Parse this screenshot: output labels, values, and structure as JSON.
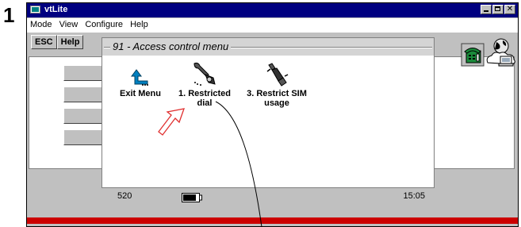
{
  "step_number": "1",
  "window": {
    "title": "vtLite",
    "menu": [
      "Mode",
      "View",
      "Configure",
      "Help"
    ]
  },
  "toolbar": {
    "esc_label": "ESC",
    "help_label": "Help"
  },
  "popup": {
    "title": "91 - Access control menu",
    "options": [
      {
        "label_line1": "Exit Menu",
        "label_line2": "",
        "icon": "back-arrow-icon"
      },
      {
        "label_line1": "1.  Restricted",
        "label_line2": "dial",
        "icon": "wrench-phone-icon"
      },
      {
        "label_line1": "3.  Restrict SIM",
        "label_line2": "usage",
        "icon": "plug-icon"
      }
    ]
  },
  "status": {
    "number": "520",
    "time": "15:05",
    "battery_icon": "battery-icon"
  },
  "icons": {
    "phone": "phone-icon",
    "globe": "globe-network-icon"
  },
  "colors": {
    "title_bar": "#000080",
    "window_bg": "#c0c0c0",
    "accent_red": "#cc0000",
    "back_arrow": "#0080c0",
    "pointer_arrow": "#e03030"
  }
}
